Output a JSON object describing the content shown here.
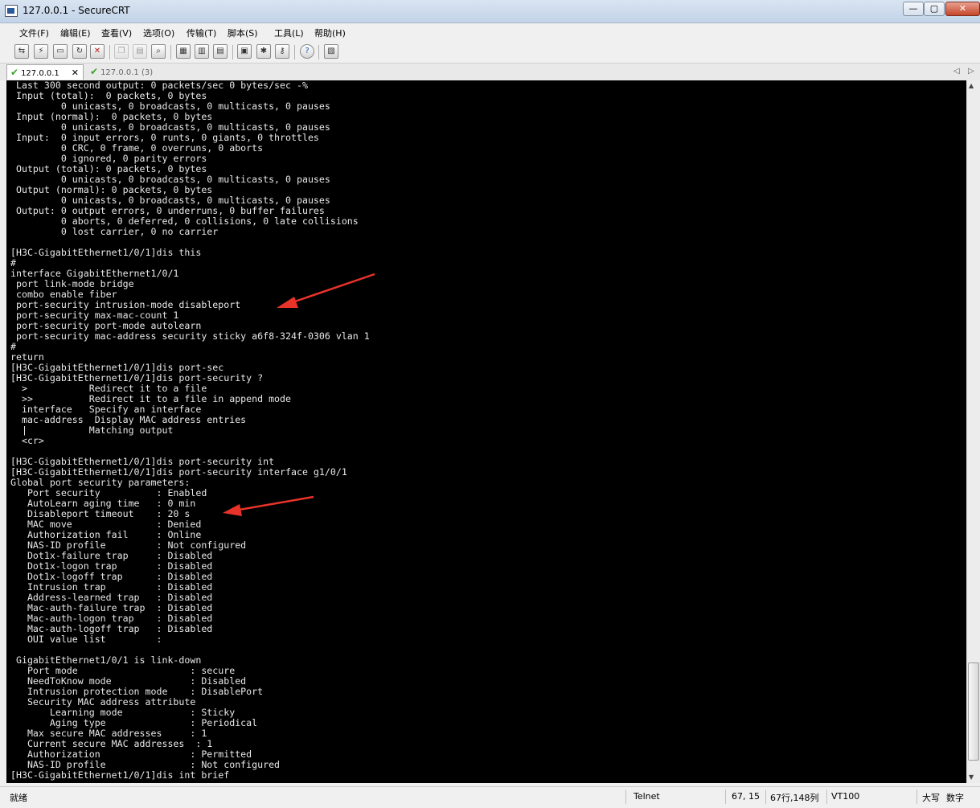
{
  "window": {
    "title": "127.0.0.1 - SecureCRT"
  },
  "window_controls": {
    "minimize": "—",
    "maximize": "▢",
    "close": "✕"
  },
  "menu": [
    "文件(F)",
    "编辑(E)",
    "查看(V)",
    "选项(O)",
    "传输(T)",
    "脚本(S)",
    "工具(L)",
    "帮助(H)"
  ],
  "toolbar_icons": [
    "connect-icon",
    "quick-connect-icon",
    "connect-in-tab-icon",
    "reconnect-icon",
    "disconnect-icon",
    "copy-icon",
    "paste-icon",
    "find-icon",
    "print-setup-icon",
    "print-icon",
    "print-selection-icon",
    "session-options-icon",
    "global-options-icon",
    "keymap-icon",
    "help-icon",
    "screen-icon"
  ],
  "tabs": [
    {
      "label": "127.0.0.1",
      "active": true
    },
    {
      "label": "127.0.0.1 (3)",
      "active": false
    }
  ],
  "terminal": {
    "lines": [
      " Last 300 second output: 0 packets/sec 0 bytes/sec -%",
      " Input (total):  0 packets, 0 bytes",
      "         0 unicasts, 0 broadcasts, 0 multicasts, 0 pauses",
      " Input (normal):  0 packets, 0 bytes",
      "         0 unicasts, 0 broadcasts, 0 multicasts, 0 pauses",
      " Input:  0 input errors, 0 runts, 0 giants, 0 throttles",
      "         0 CRC, 0 frame, 0 overruns, 0 aborts",
      "         0 ignored, 0 parity errors",
      " Output (total): 0 packets, 0 bytes",
      "         0 unicasts, 0 broadcasts, 0 multicasts, 0 pauses",
      " Output (normal): 0 packets, 0 bytes",
      "         0 unicasts, 0 broadcasts, 0 multicasts, 0 pauses",
      " Output: 0 output errors, 0 underruns, 0 buffer failures",
      "         0 aborts, 0 deferred, 0 collisions, 0 late collisions",
      "         0 lost carrier, 0 no carrier",
      "",
      "[H3C-GigabitEthernet1/0/1]dis this",
      "#",
      "interface GigabitEthernet1/0/1",
      " port link-mode bridge",
      " combo enable fiber",
      " port-security intrusion-mode disableport",
      " port-security max-mac-count 1",
      " port-security port-mode autolearn",
      " port-security mac-address security sticky a6f8-324f-0306 vlan 1",
      "#",
      "return",
      "[H3C-GigabitEthernet1/0/1]dis port-sec",
      "[H3C-GigabitEthernet1/0/1]dis port-security ?",
      "  >           Redirect it to a file",
      "  >>          Redirect it to a file in append mode",
      "  interface   Specify an interface",
      "  mac-address  Display MAC address entries",
      "  |           Matching output",
      "  <cr>",
      "",
      "[H3C-GigabitEthernet1/0/1]dis port-security int",
      "[H3C-GigabitEthernet1/0/1]dis port-security interface g1/0/1",
      "Global port security parameters:",
      "   Port security          : Enabled",
      "   AutoLearn aging time   : 0 min",
      "   Disableport timeout    : 20 s",
      "   MAC move               : Denied",
      "   Authorization fail     : Online",
      "   NAS-ID profile         : Not configured",
      "   Dot1x-failure trap     : Disabled",
      "   Dot1x-logon trap       : Disabled",
      "   Dot1x-logoff trap      : Disabled",
      "   Intrusion trap         : Disabled",
      "   Address-learned trap   : Disabled",
      "   Mac-auth-failure trap  : Disabled",
      "   Mac-auth-logon trap    : Disabled",
      "   Mac-auth-logoff trap   : Disabled",
      "   OUI value list         :",
      "",
      " GigabitEthernet1/0/1 is link-down",
      "   Port mode                    : secure",
      "   NeedToKnow mode              : Disabled",
      "   Intrusion protection mode    : DisablePort",
      "   Security MAC address attribute",
      "       Learning mode            : Sticky",
      "       Aging type               : Periodical",
      "   Max secure MAC addresses     : 1",
      "   Current secure MAC addresses  : 1",
      "   Authorization                : Permitted",
      "   NAS-ID profile               : Not configured",
      "[H3C-GigabitEthernet1/0/1]dis int brief"
    ]
  },
  "annotation_color": "#e8332a",
  "status": {
    "ready": "就绪",
    "protocol": "Telnet",
    "cursor": "67, 15",
    "size": "67行,148列",
    "terminal_type": "VT100",
    "caps": "大写",
    "num": "数字"
  }
}
